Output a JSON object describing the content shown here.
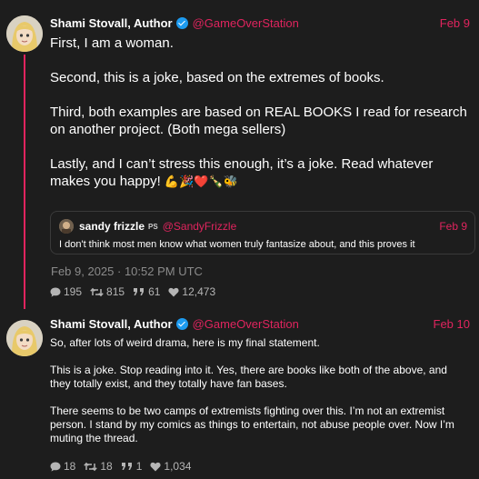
{
  "colors": {
    "accent": "#e0245e",
    "background": "#1d1d1d",
    "verified": "#1d9bf0",
    "muted": "#8b8b8b"
  },
  "post1": {
    "author_name": "Shami Stovall, Author",
    "handle": "@GameOverStation",
    "date": "Feb 9",
    "paragraphs": [
      "First, I am a woman.",
      "Second, this is a joke, based on the extremes of books.",
      "Third, both examples are based on REAL BOOKS I read for research on another project. (Both mega sellers)",
      "Lastly, and I can’t stress this enough, it’s a joke. Read whatever makes you happy!"
    ],
    "emojis": "💪🎉❤️🍾🐝",
    "quote": {
      "author_name": "sandy frizzle",
      "badge": "PS",
      "handle": "@SandyFrizzle",
      "date": "Feb 9",
      "text": "I don't think most men know what women truly fantasize about, and this proves it"
    },
    "timestamp": "Feb 9, 2025 · 10:52 PM UTC",
    "stats": {
      "replies": "195",
      "retweets": "815",
      "quotes": "61",
      "likes": "12,473"
    }
  },
  "post2": {
    "author_name": "Shami Stovall, Author",
    "handle": "@GameOverStation",
    "date": "Feb 10",
    "paragraphs": [
      "So, after lots of weird drama, here is my final statement.",
      "This is a joke. Stop reading into it. Yes, there are books like both of the above, and they totally exist, and they totally have fan bases.",
      "There seems to be two camps of extremists fighting over this. I’m not an extremist person. I stand by my comics as things to entertain, not abuse people over. Now I’m muting the thread."
    ],
    "stats": {
      "replies": "18",
      "retweets": "18",
      "quotes": "1",
      "likes": "1,034"
    }
  }
}
